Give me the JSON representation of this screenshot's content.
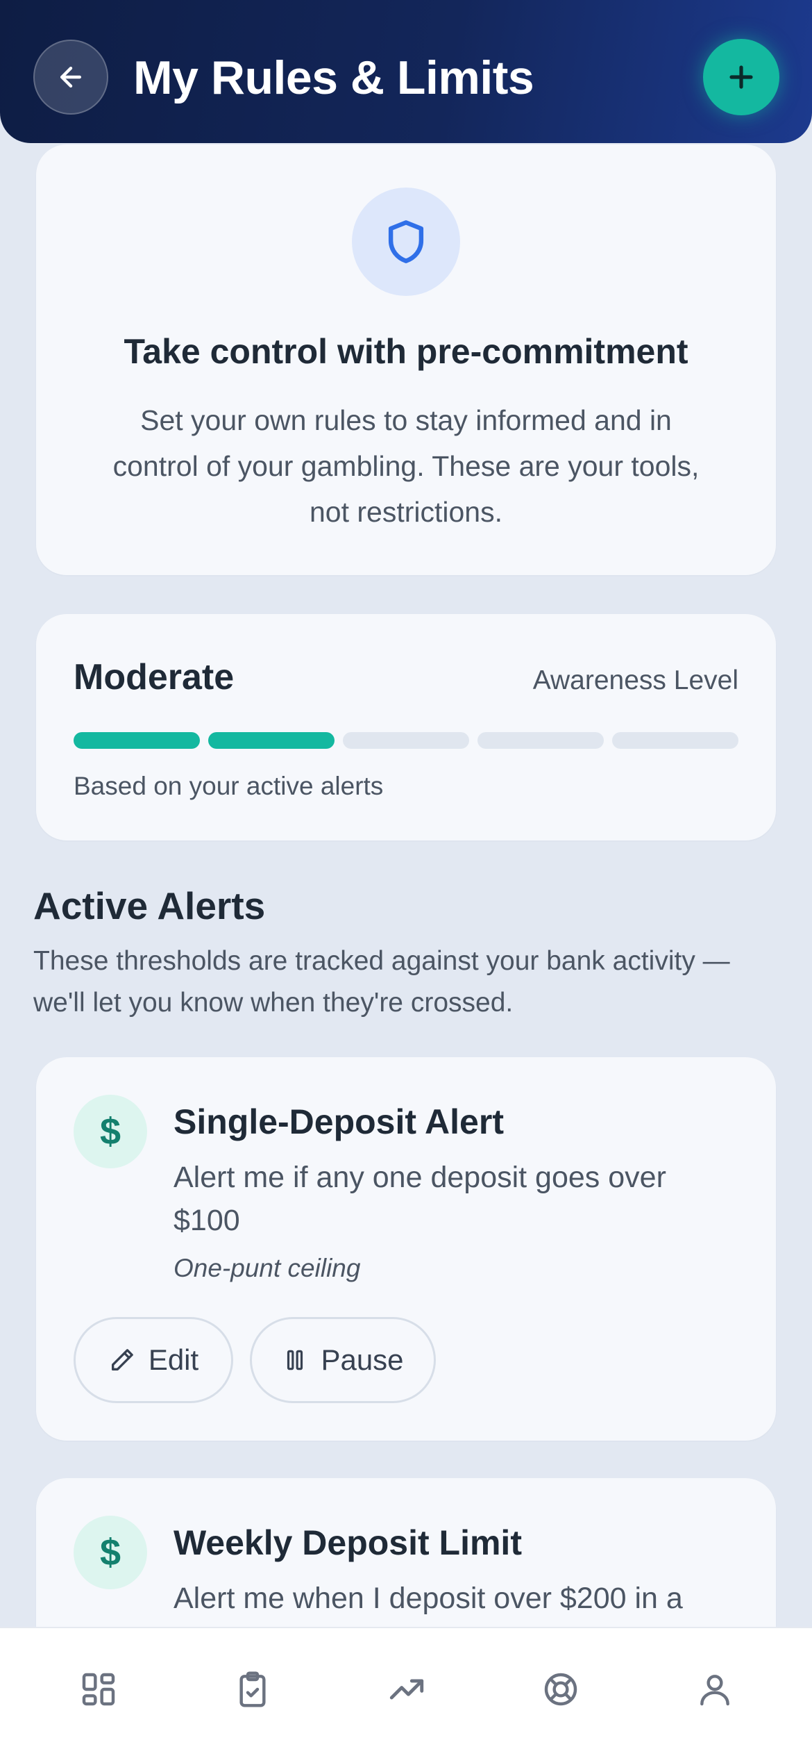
{
  "header": {
    "title": "My Rules & Limits",
    "back_icon": "arrow-left-icon",
    "add_icon": "plus-icon",
    "gradient_colors": [
      "#0e1d44",
      "#1c3a8e"
    ],
    "accent": "#14b8a0"
  },
  "intro": {
    "icon": "shield-icon",
    "heading": "Take control with pre-commitment",
    "body": "Set your own rules to stay informed and in control of your gambling. These are your tools, not restrictions."
  },
  "awareness": {
    "level": "Moderate",
    "caption": "Awareness Level",
    "filled_segments": 2,
    "total_segments": 5,
    "note": "Based on your active alerts"
  },
  "active_alerts": {
    "title": "Active Alerts",
    "description": "These thresholds are tracked against your bank activity — we'll let you know when they're crossed.",
    "items": [
      {
        "icon": "dollar-icon",
        "icon_glyph": "$",
        "title": "Single-Deposit Alert",
        "description": "Alert me if any one deposit goes over $100",
        "tag": "One-punt ceiling",
        "edit_label": "Edit",
        "pause_label": "Pause"
      },
      {
        "icon": "dollar-icon",
        "icon_glyph": "$",
        "title": "Weekly Deposit Limit",
        "description": "Alert me when I deposit over $200 in a"
      }
    ]
  },
  "bottom_nav": {
    "items": [
      {
        "icon": "dashboard-icon"
      },
      {
        "icon": "clipboard-check-icon"
      },
      {
        "icon": "trending-up-icon"
      },
      {
        "icon": "lifebuoy-icon"
      },
      {
        "icon": "user-icon"
      }
    ]
  }
}
